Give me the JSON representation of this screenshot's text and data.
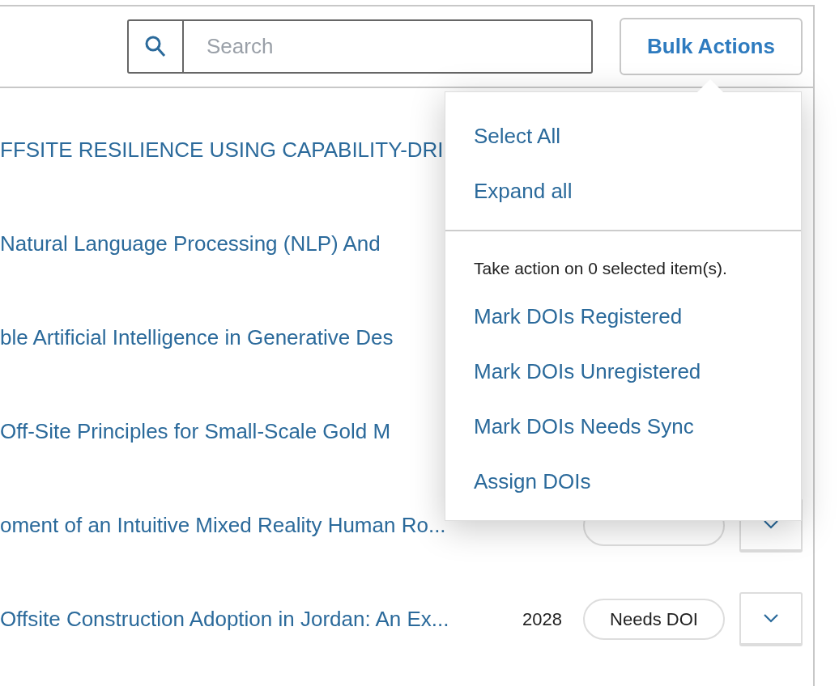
{
  "search": {
    "placeholder": "Search"
  },
  "bulk_actions": {
    "label": "Bulk Actions",
    "expanded": true
  },
  "menu": {
    "top_items": [
      "Select All",
      "Expand all"
    ],
    "note": "Take action on 0 selected item(s).",
    "action_items": [
      "Mark DOIs Registered",
      "Mark DOIs Unregistered",
      "Mark DOIs Needs Sync",
      "Assign DOIs"
    ]
  },
  "rows": [
    {
      "kind": "hidden",
      "title": "FFSITE RESILIENCE USING CAPABILITY-DRI"
    },
    {
      "kind": "hidden",
      "title": "Natural Language Processing (NLP) And"
    },
    {
      "kind": "hidden",
      "title": "ble Artificial Intelligence in Generative Des"
    },
    {
      "kind": "hidden",
      "title": "Off-Site Principles for Small-Scale Gold M"
    },
    {
      "kind": "covered",
      "title": "oment of an Intuitive Mixed Reality Human Ro..."
    },
    {
      "kind": "full",
      "title": "Offsite Construction Adoption in Jordan: An Ex...",
      "year": "2028",
      "status": "Needs DOI"
    }
  ]
}
